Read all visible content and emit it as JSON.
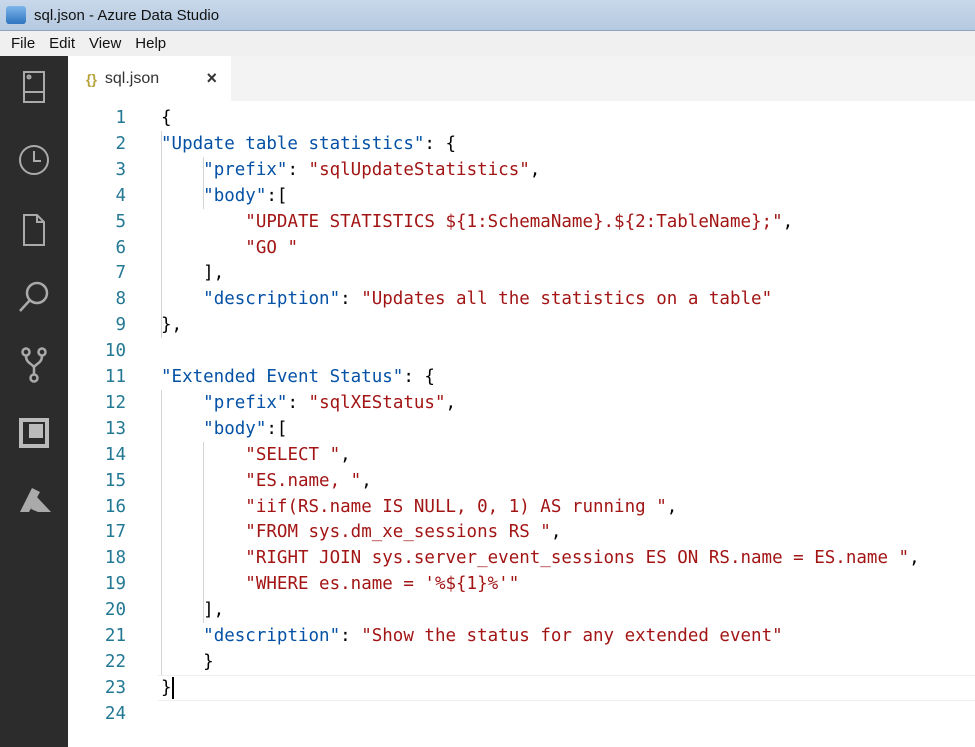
{
  "window": {
    "title": "sql.json - Azure Data Studio"
  },
  "menu": [
    "File",
    "Edit",
    "View",
    "Help"
  ],
  "activity_bar": [
    "servers-icon",
    "history-icon",
    "file-icon",
    "search-icon",
    "source-control-icon",
    "extensions-icon",
    "azure-icon"
  ],
  "tab": {
    "icon": "{}",
    "label": "sql.json",
    "close": "×"
  },
  "lines": [
    [
      [
        "p",
        "{"
      ]
    ],
    [
      [
        "k",
        "\"Update table statistics\""
      ],
      [
        "p",
        ": {"
      ]
    ],
    [
      [
        "p",
        "    "
      ],
      [
        "k",
        "\"prefix\""
      ],
      [
        "p",
        ": "
      ],
      [
        "s",
        "\"sqlUpdateStatistics\""
      ],
      [
        "p",
        ","
      ]
    ],
    [
      [
        "p",
        "    "
      ],
      [
        "k",
        "\"body\""
      ],
      [
        "p",
        ":["
      ]
    ],
    [
      [
        "p",
        "        "
      ],
      [
        "s",
        "\"UPDATE STATISTICS ${1:SchemaName}.${2:TableName};\""
      ],
      [
        "p",
        ","
      ]
    ],
    [
      [
        "p",
        "        "
      ],
      [
        "s",
        "\"GO \""
      ]
    ],
    [
      [
        "p",
        "    ],"
      ]
    ],
    [
      [
        "p",
        "    "
      ],
      [
        "k",
        "\"description\""
      ],
      [
        "p",
        ": "
      ],
      [
        "s",
        "\"Updates all the statistics on a table\""
      ]
    ],
    [
      [
        "p",
        "},"
      ]
    ],
    [],
    [
      [
        "k",
        "\"Extended Event Status\""
      ],
      [
        "p",
        ": {"
      ]
    ],
    [
      [
        "p",
        "    "
      ],
      [
        "k",
        "\"prefix\""
      ],
      [
        "p",
        ": "
      ],
      [
        "s",
        "\"sqlXEStatus\""
      ],
      [
        "p",
        ","
      ]
    ],
    [
      [
        "p",
        "    "
      ],
      [
        "k",
        "\"body\""
      ],
      [
        "p",
        ":["
      ]
    ],
    [
      [
        "p",
        "        "
      ],
      [
        "s",
        "\"SELECT \""
      ],
      [
        "p",
        ","
      ]
    ],
    [
      [
        "p",
        "        "
      ],
      [
        "s",
        "\"ES.name, \""
      ],
      [
        "p",
        ","
      ]
    ],
    [
      [
        "p",
        "        "
      ],
      [
        "s",
        "\"iif(RS.name IS NULL, 0, 1) AS running \""
      ],
      [
        "p",
        ","
      ]
    ],
    [
      [
        "p",
        "        "
      ],
      [
        "s",
        "\"FROM sys.dm_xe_sessions RS \""
      ],
      [
        "p",
        ","
      ]
    ],
    [
      [
        "p",
        "        "
      ],
      [
        "s",
        "\"RIGHT JOIN sys.server_event_sessions ES ON RS.name = ES.name \""
      ],
      [
        "p",
        ","
      ]
    ],
    [
      [
        "p",
        "        "
      ],
      [
        "s",
        "\"WHERE es.name = '%${1}%'\""
      ]
    ],
    [
      [
        "p",
        "    ],"
      ]
    ],
    [
      [
        "p",
        "    "
      ],
      [
        "k",
        "\"description\""
      ],
      [
        "p",
        ": "
      ],
      [
        "s",
        "\"Show the status for any extended event\""
      ]
    ],
    [
      [
        "p",
        "    }"
      ]
    ],
    [
      [
        "p",
        "}"
      ]
    ],
    []
  ]
}
